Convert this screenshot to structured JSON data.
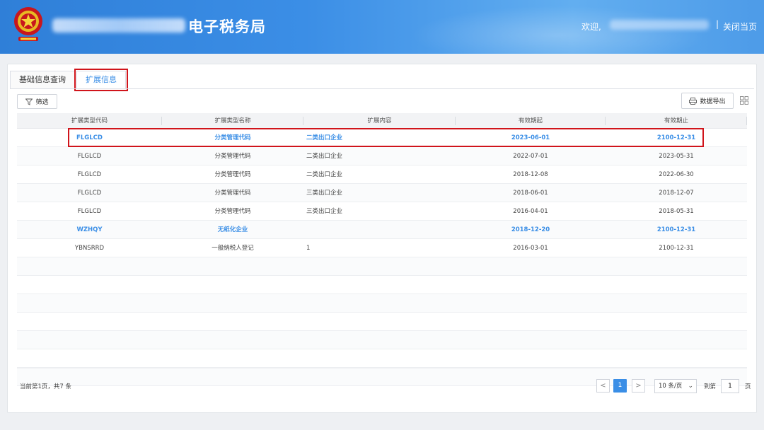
{
  "header": {
    "app_title": "电子税务局",
    "welcome": "欢迎,",
    "separator": "|",
    "close_page": "关闭当页"
  },
  "tabs": [
    {
      "label": "基础信息查询",
      "active": false
    },
    {
      "label": "扩展信息",
      "active": true
    }
  ],
  "toolbar": {
    "filter_label": "筛选",
    "export_label": "数据导出"
  },
  "table": {
    "columns": [
      "扩展类型代码",
      "扩展类型名称",
      "扩展内容",
      "有效期起",
      "有效期止"
    ],
    "rows": [
      {
        "code": "FLGLCD",
        "name": "分类管理代码",
        "content": "二类出口企业",
        "start": "2023-06-01",
        "end": "2100-12-31",
        "highlight": true
      },
      {
        "code": "FLGLCD",
        "name": "分类管理代码",
        "content": "二类出口企业",
        "start": "2022-07-01",
        "end": "2023-05-31",
        "highlight": false
      },
      {
        "code": "FLGLCD",
        "name": "分类管理代码",
        "content": "二类出口企业",
        "start": "2018-12-08",
        "end": "2022-06-30",
        "highlight": false
      },
      {
        "code": "FLGLCD",
        "name": "分类管理代码",
        "content": "三类出口企业",
        "start": "2018-06-01",
        "end": "2018-12-07",
        "highlight": false
      },
      {
        "code": "FLGLCD",
        "name": "分类管理代码",
        "content": "三类出口企业",
        "start": "2016-04-01",
        "end": "2018-05-31",
        "highlight": false
      },
      {
        "code": "WZHQY",
        "name": "无纸化企业",
        "content": "",
        "start": "2018-12-20",
        "end": "2100-12-31",
        "highlight": true
      },
      {
        "code": "YBNSRRD",
        "name": "一般纳税人登记",
        "content": "1",
        "start": "2016-03-01",
        "end": "2100-12-31",
        "highlight": false
      },
      {
        "code": "",
        "name": "",
        "content": "",
        "start": "",
        "end": "",
        "highlight": false
      },
      {
        "code": "",
        "name": "",
        "content": "",
        "start": "",
        "end": "",
        "highlight": false
      },
      {
        "code": "",
        "name": "",
        "content": "",
        "start": "",
        "end": "",
        "highlight": false
      },
      {
        "code": "",
        "name": "",
        "content": "",
        "start": "",
        "end": "",
        "highlight": false
      },
      {
        "code": "",
        "name": "",
        "content": "",
        "start": "",
        "end": "",
        "highlight": false
      },
      {
        "code": "",
        "name": "",
        "content": "",
        "start": "",
        "end": "",
        "highlight": false
      },
      {
        "code": "",
        "name": "",
        "content": "",
        "start": "",
        "end": "",
        "highlight": false
      }
    ]
  },
  "pagination": {
    "info": "当前第1页，共7 条",
    "current_page": "1",
    "prev": "<",
    "next": ">",
    "page_size": "10 条/页",
    "goto_label": "到第",
    "goto_value": "1",
    "page_unit": "页"
  },
  "colors": {
    "accent": "#3a8ee6",
    "highlight_border": "#d0141b",
    "header_blue": "#2f7fd8"
  }
}
